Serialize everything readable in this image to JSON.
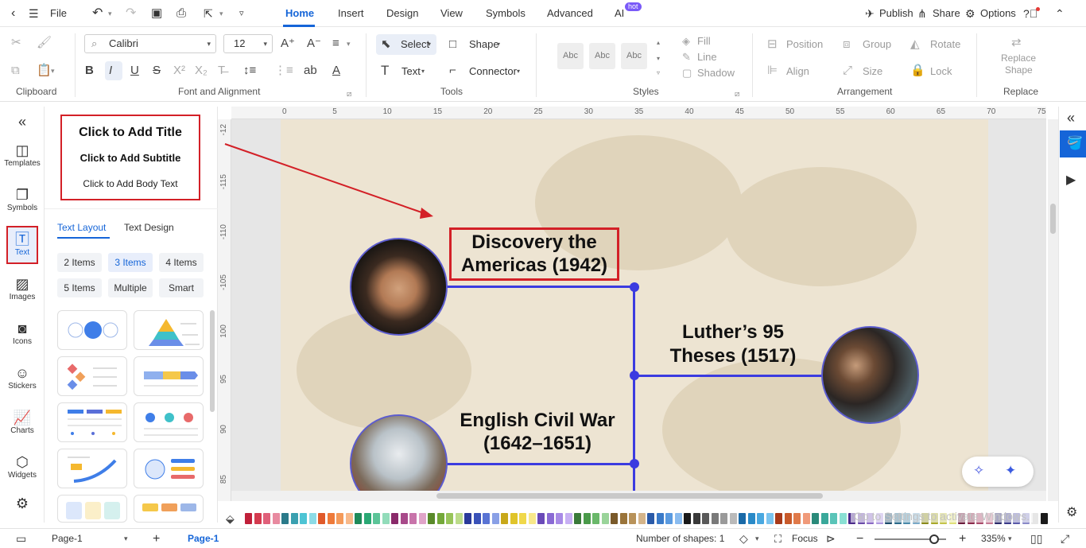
{
  "titlebar": {
    "file": "File",
    "tabs": [
      "Home",
      "Insert",
      "Design",
      "View",
      "Symbols",
      "Advanced",
      "AI"
    ],
    "active_tab": "Home",
    "hot_badge": "hot",
    "publish": "Publish",
    "share": "Share",
    "options": "Options"
  },
  "ribbon": {
    "groups": {
      "clipboard": "Clipboard",
      "font": "Font and Alignment",
      "tools": "Tools",
      "styles": "Styles",
      "arrangement": "Arrangement",
      "replace": "Replace"
    },
    "font_name": "Calibri",
    "font_size": "12",
    "select": "Select",
    "shape": "Shape",
    "text": "Text",
    "connector": "Connector",
    "abc": "Abc",
    "fill": "Fill",
    "line": "Line",
    "shadow": "Shadow",
    "position": "Position",
    "group": "Group",
    "rotate": "Rotate",
    "align": "Align",
    "size": "Size",
    "lock": "Lock",
    "replace_shape_1": "Replace",
    "replace_shape_2": "Shape"
  },
  "left_rail": [
    "Templates",
    "Symbols",
    "Text",
    "Images",
    "Icons",
    "Stickers",
    "Charts",
    "Widgets"
  ],
  "panel": {
    "preview_title": "Click to Add Title",
    "preview_subtitle": "Click to Add Subtitle",
    "preview_body": "Click to Add Body Text",
    "tabs": [
      "Text Layout",
      "Text Design"
    ],
    "chips": [
      "2 Items",
      "3 Items",
      "4 Items",
      "5 Items",
      "Multiple",
      "Smart"
    ],
    "active_chip": "3 Items"
  },
  "hruler_ticks": [
    "0",
    "5",
    "10",
    "15",
    "20",
    "25",
    "30",
    "35",
    "40",
    "45",
    "50",
    "55",
    "60",
    "65",
    "70",
    "75"
  ],
  "vruler_ticks": [
    "-12",
    "-115",
    "-110",
    "-105",
    "100",
    "95",
    "90",
    "85"
  ],
  "canvas": {
    "event1": {
      "line1": "Discovery the",
      "line2": "Americas (1942)"
    },
    "event2": {
      "line1": "Luther’s 95",
      "line2": "Theses (1517)"
    },
    "event3": {
      "line1": "English Civil War",
      "line2": "(1642–1651)"
    },
    "watermark": "Go to Settings to activate Windows."
  },
  "statusbar": {
    "page_tab": "Page-1",
    "page_active": "Page-1",
    "shapes": "Number of shapes: 1",
    "focus": "Focus",
    "zoom": "335%"
  },
  "colors": {
    "accent": "#1565d8",
    "timeline": "#3b3be0",
    "highlight": "#d32027"
  }
}
